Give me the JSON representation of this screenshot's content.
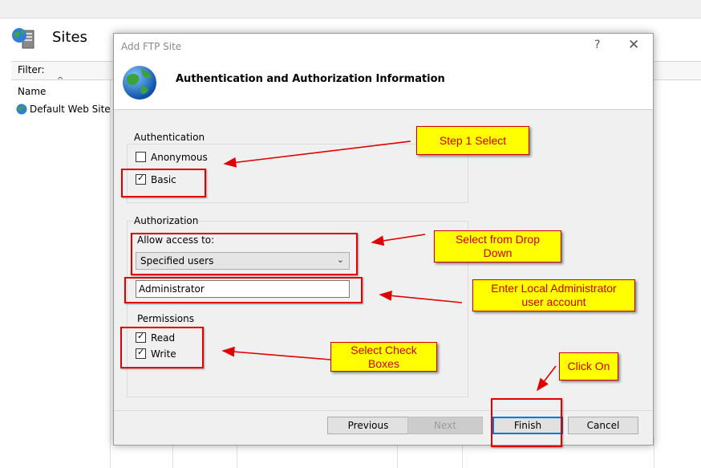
{
  "background": {
    "sites_title": "Sites",
    "filter_label": "Filter:",
    "sort_caret": "^",
    "name_header": "Name",
    "tree_items": [
      {
        "label": "Default Web Site"
      }
    ]
  },
  "dialog": {
    "title": "Add FTP Site",
    "help_glyph": "?",
    "close_glyph": "✕",
    "heading": "Authentication and Authorization Information",
    "authentication": {
      "label": "Authentication",
      "anonymous": {
        "label": "Anonymous",
        "checked": false
      },
      "basic": {
        "label": "Basic",
        "checked": true
      }
    },
    "authorization": {
      "label": "Authorization",
      "allow_access_label": "Allow access to:",
      "allow_access_value": "Specified users",
      "user_value": "Administrator",
      "permissions_label": "Permissions",
      "read": {
        "label": "Read",
        "checked": true
      },
      "write": {
        "label": "Write",
        "checked": true
      }
    },
    "buttons": {
      "previous": "Previous",
      "next": "Next",
      "finish": "Finish",
      "cancel": "Cancel"
    }
  },
  "annotations": {
    "step1": "Step 1 Select",
    "dropdown": "Select from Drop Down",
    "admin": "Enter Local Administrator user account",
    "checkboxes": "Select Check Boxes",
    "click_on": "Click On"
  },
  "icons": {
    "sites": "server-globe-icon",
    "dialog": "globe-icon",
    "checkmark": "✓",
    "chevron": "⌄"
  },
  "colors": {
    "callout_fill": "#ffff00",
    "callout_text": "#cc0000",
    "highlight_border": "#e00000",
    "primary_button_border": "#0078d7"
  }
}
